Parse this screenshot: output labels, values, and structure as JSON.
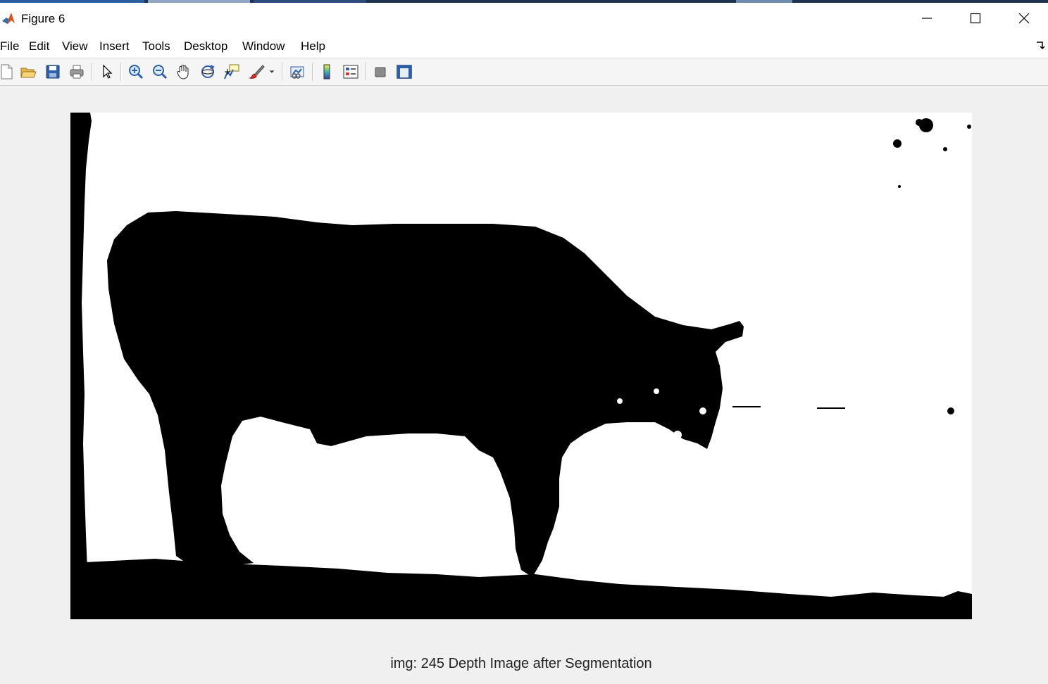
{
  "window": {
    "title": "Figure 6"
  },
  "menu": [
    "File",
    "Edit",
    "View",
    "Insert",
    "Tools",
    "Desktop",
    "Window",
    "Help"
  ],
  "toolbar": {
    "tools": [
      "new-figure-icon",
      "open-file-icon",
      "save-icon",
      "print-icon",
      "pointer-icon",
      "zoom-in-icon",
      "zoom-out-icon",
      "pan-hand-icon",
      "rotate-3d-icon",
      "data-cursor-icon",
      "brush-icon",
      "link-plot-icon",
      "colorbar-icon",
      "legend-icon",
      "hide-plot-tools-icon",
      "show-plot-tools-icon"
    ]
  },
  "figure": {
    "caption": "img: 245 Depth Image after Segmentation"
  },
  "colors": {
    "foreground": "#000000",
    "background": "#ffffff",
    "window_bg": "#f0f0f0"
  }
}
